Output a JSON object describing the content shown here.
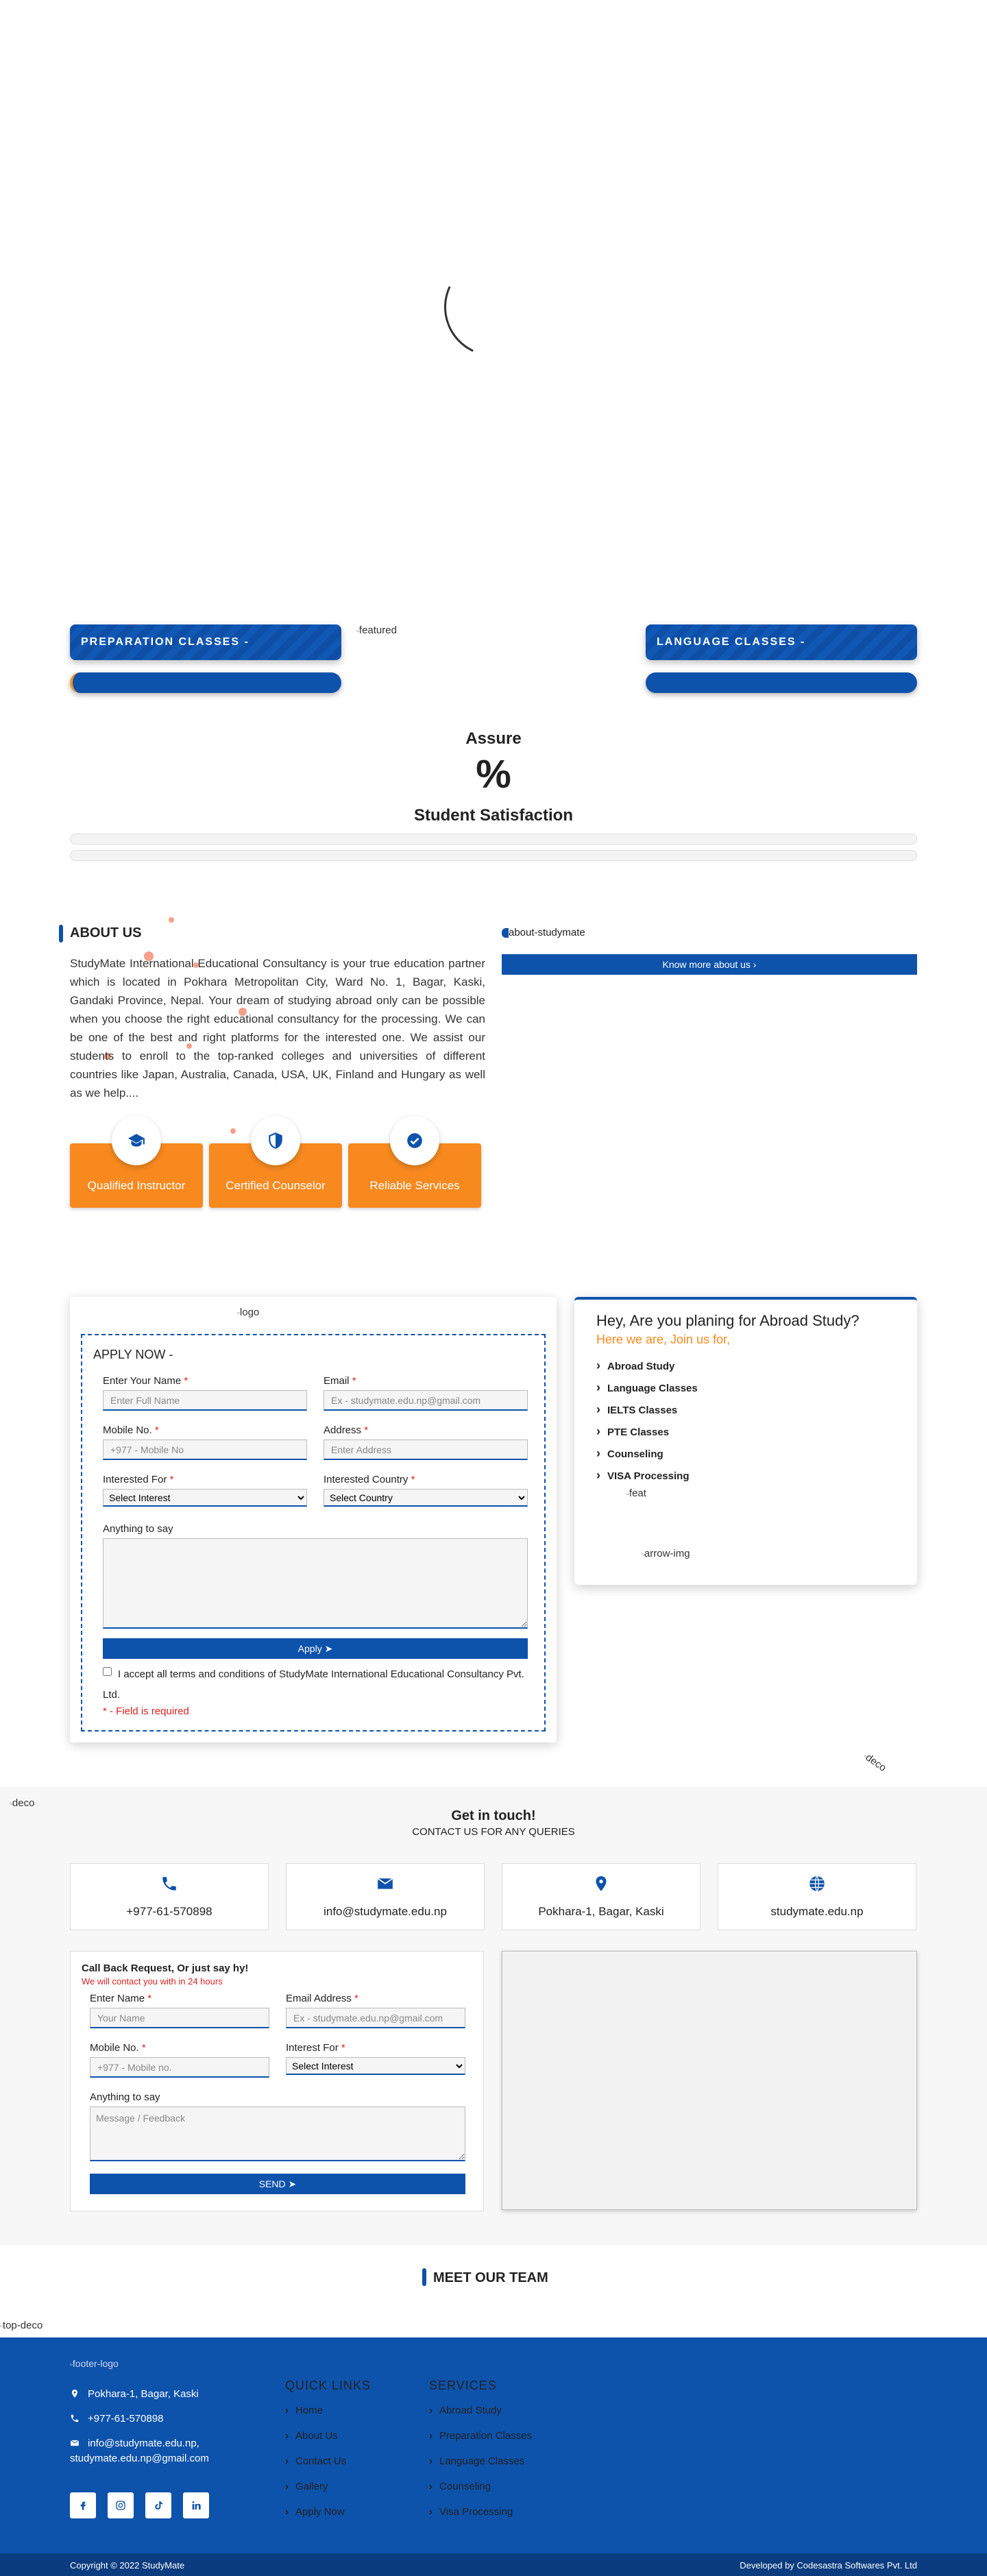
{
  "classes": {
    "preparation": "PREPARATION CLASSES -",
    "language": "LANGUAGE CLASSES -",
    "featured_alt": "featured"
  },
  "assure": {
    "title": "Assure",
    "value": "%",
    "subtitle": "Student Satisfaction"
  },
  "about": {
    "title": "ABOUT US",
    "text": "StudyMate International Educational Consultancy is your true education partner which is located in Pokhara Metropolitan City, Ward No. 1, Bagar, Kaski, Gandaki Province, Nepal. Your dream of studying abroad only can be possible when you choose the right educational consultancy for the processing. We can be one of the best and right platforms for the interested one. We assist our students to enroll to the top-ranked colleges and universities of different countries like Japan, Australia, Canada, USA, UK, Finland and Hungary as well as we help....",
    "image_alt": "about-studymate",
    "button": "Know more about us",
    "features": [
      {
        "label": "Qualified Instructor",
        "icon": "graduation-cap-icon"
      },
      {
        "label": "Certified Counselor",
        "icon": "shield-icon"
      },
      {
        "label": "Reliable Services",
        "icon": "check-circle-icon"
      }
    ]
  },
  "apply": {
    "logo_alt": "logo",
    "heading": "APPLY NOW -",
    "name_label": "Enter Your Name",
    "name_placeholder": "Enter Full Name",
    "email_label": "Email",
    "email_placeholder": "Ex - studymate.edu.np@gmail.com",
    "mobile_label": "Mobile No.",
    "mobile_placeholder": "+977 - Mobile No",
    "address_label": "Address",
    "address_placeholder": "Enter Address",
    "interest_label": "Interested For",
    "interest_selected": "Select Interest",
    "country_label": "Interested Country",
    "country_selected": "Select Country",
    "say_label": "Anything to say",
    "submit": "Apply",
    "terms": "I accept all terms and conditions of StudyMate International Educational Consultancy Pvt. Ltd.",
    "required_note": "* - Field is required",
    "req_mark": "*"
  },
  "abroad": {
    "title": "Hey, Are you planing for Abroad Study?",
    "subtitle": "Here we are, Join us for,",
    "items": [
      "Abroad Study",
      "Language Classes",
      "IELTS Classes",
      "PTE Classes",
      "Counseling",
      "VISA Processing"
    ],
    "feat_alt": "feat",
    "arrow_alt": "arrow-img"
  },
  "deco": {
    "deco_alt": "deco",
    "top_deco_alt": "top-deco"
  },
  "contact": {
    "title": "Get in touch!",
    "subtitle": "CONTACT US FOR ANY QUERIES",
    "phone": "+977-61-570898",
    "email": "info@studymate.edu.np",
    "location": "Pokhara-1, Bagar, Kaski",
    "website": "studymate.edu.np",
    "callback_title": "Call Back Request, Or just say hy!",
    "callback_sub": "We will contact you with in 24 hours",
    "name_label": "Enter Name",
    "name_placeholder": "Your Name",
    "email_label": "Email Address",
    "email_placeholder": "Ex - studymate.edu.np@gmail.com",
    "mobile_label": "Mobile No.",
    "mobile_placeholder": "+977 - Mobile no.",
    "interest_label": "Interest For",
    "interest_selected": "Select Interest",
    "say_label": "Anything to say",
    "say_placeholder": "Message / Feedback",
    "send": "SEND"
  },
  "team": {
    "title": "MEET OUR TEAM"
  },
  "footer": {
    "logo_alt": "footer-logo",
    "address": "Pokhara-1, Bagar, Kaski",
    "phone": "+977-61-570898",
    "email_line1": "info@studymate.edu.np,",
    "email_line2": "studymate.edu.np@gmail.com",
    "quick_title": "QUICK LINKS",
    "quick_links": [
      "Home",
      "About Us",
      "Contact Us",
      "Gallery",
      "Apply Now"
    ],
    "services_title": "SERVICES",
    "services": [
      "Abroad Study",
      "Preparation Classes",
      "Language Classes",
      "Counseling",
      "Visa Processing"
    ],
    "social": [
      "facebook-icon",
      "instagram-icon",
      "tiktok-icon",
      "linkedin-icon"
    ],
    "copyright": "Copyright © 2022 StudyMate",
    "developer": "Developed by Codesastra Softwares Pvt. Ltd"
  },
  "colors": {
    "primary": "#0d52ab",
    "accent": "#f7891f",
    "required": "#dd2222"
  }
}
